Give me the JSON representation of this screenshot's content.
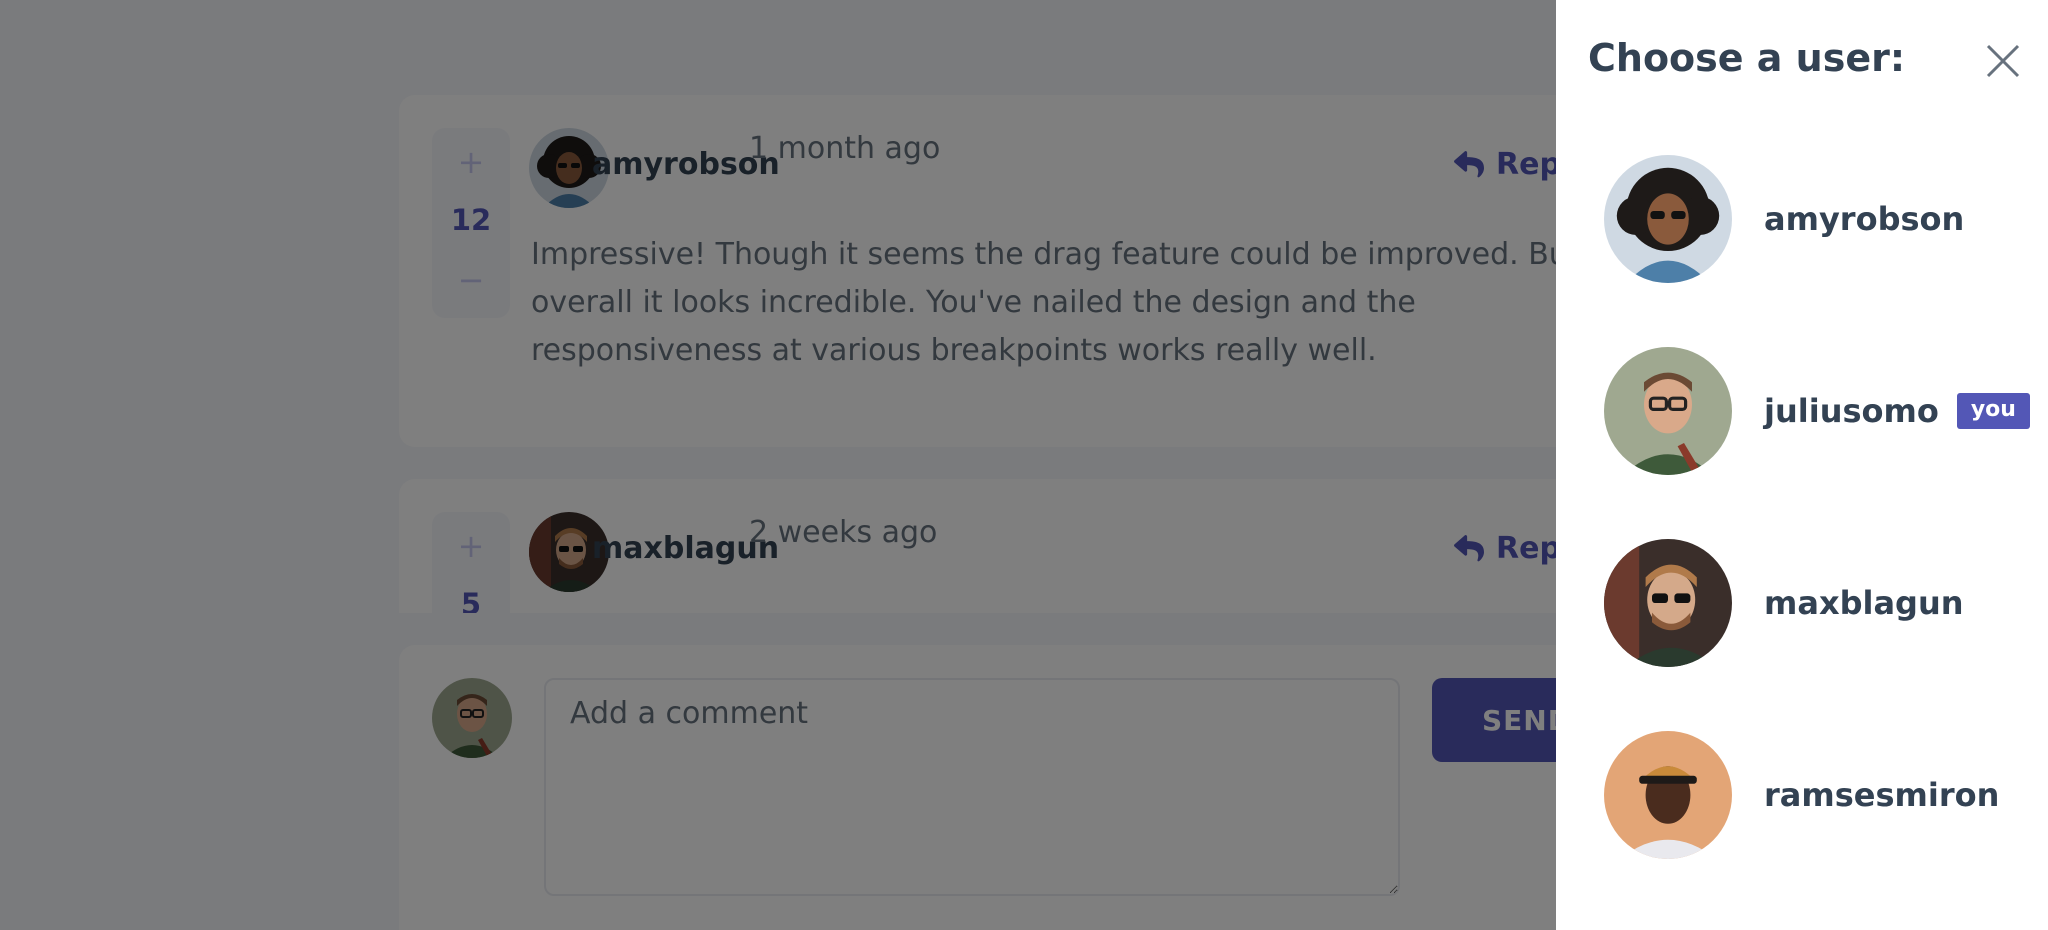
{
  "colors": {
    "primary": "#5357b6",
    "vote_light": "#c5c6ef",
    "text_dark": "#334253",
    "text_muted": "#67727e",
    "page_bg": "#f5f6fa",
    "overlay": "rgba(0,0,0,0.5)"
  },
  "comments": [
    {
      "author": "amyrobson",
      "time": "1 month ago",
      "score": "12",
      "reply_label": "Reply",
      "avatar_icon": "avatar-curly-hair-sunglasses",
      "text": "Impressive! Though it seems the drag feature could be improved. But overall it looks incredible. You've nailed the design and the responsiveness at various breakpoints works really well."
    },
    {
      "author": "maxblagun",
      "time": "2 weeks ago",
      "score": "5",
      "reply_label": "Reply",
      "avatar_icon": "avatar-sunglasses-beard"
    }
  ],
  "vote": {
    "plus": "+",
    "minus": "−"
  },
  "composer": {
    "placeholder": "Add a comment",
    "send_label": "SEND"
  },
  "user_chooser": {
    "title": "Choose a user:",
    "close_icon": "close-icon",
    "users": [
      {
        "name": "amyrobson",
        "avatar_icon": "avatar-curly-hair-sunglasses"
      },
      {
        "name": "juliusomo",
        "badge": "you",
        "avatar_icon": "avatar-glasses-short-hair"
      },
      {
        "name": "maxblagun",
        "avatar_icon": "avatar-sunglasses-beard"
      },
      {
        "name": "ramsesmiron",
        "avatar_icon": "avatar-cap"
      }
    ]
  }
}
